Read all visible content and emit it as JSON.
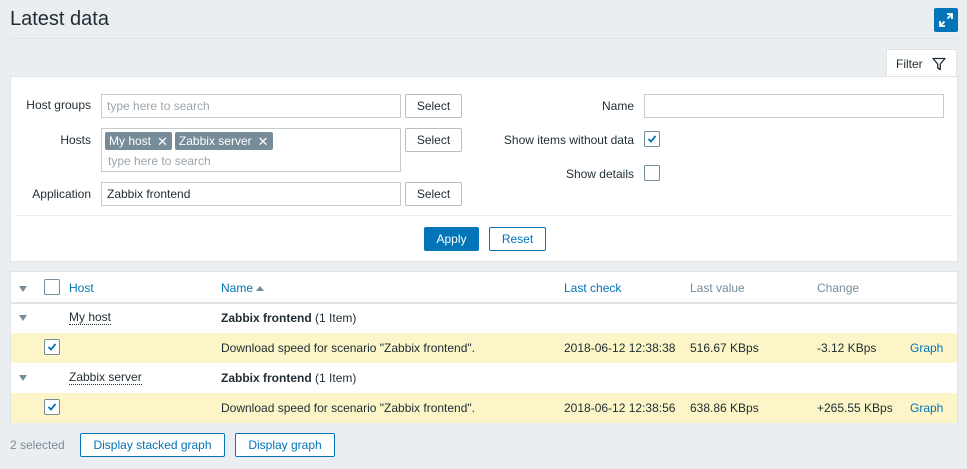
{
  "header": {
    "title": "Latest data"
  },
  "filter": {
    "tab_label": "Filter",
    "host_groups": {
      "label": "Host groups",
      "placeholder": "type here to search",
      "select_label": "Select"
    },
    "hosts": {
      "label": "Hosts",
      "tags": [
        "My host",
        "Zabbix server"
      ],
      "placeholder": "type here to search",
      "select_label": "Select"
    },
    "application": {
      "label": "Application",
      "value": "Zabbix frontend",
      "select_label": "Select"
    },
    "name": {
      "label": "Name",
      "value": ""
    },
    "show_items_without_data": {
      "label": "Show items without data",
      "checked": true
    },
    "show_details": {
      "label": "Show details",
      "checked": false
    },
    "apply_label": "Apply",
    "reset_label": "Reset"
  },
  "table": {
    "columns": {
      "host": "Host",
      "name": "Name",
      "last_check": "Last check",
      "last_value": "Last value",
      "change": "Change"
    },
    "groups": [
      {
        "host": "My host",
        "application": "Zabbix frontend",
        "count": "(1 Item)",
        "item": {
          "name": "Download speed for scenario \"Zabbix frontend\".",
          "last_check": "2018-06-12 12:38:38",
          "last_value": "516.67 KBps",
          "change": "-3.12 KBps",
          "action": "Graph",
          "checked": true
        }
      },
      {
        "host": "Zabbix server",
        "application": "Zabbix frontend",
        "count": "(1 Item)",
        "item": {
          "name": "Download speed for scenario \"Zabbix frontend\".",
          "last_check": "2018-06-12 12:38:56",
          "last_value": "638.86 KBps",
          "change": "+265.55 KBps",
          "action": "Graph",
          "checked": true
        }
      }
    ]
  },
  "footer": {
    "selected_text": "2 selected",
    "stacked_graph_label": "Display stacked graph",
    "graph_label": "Display graph"
  },
  "colors": {
    "accent": "#0275b8",
    "row_highlight": "#fbf5c7",
    "background": "#ebeef0"
  }
}
